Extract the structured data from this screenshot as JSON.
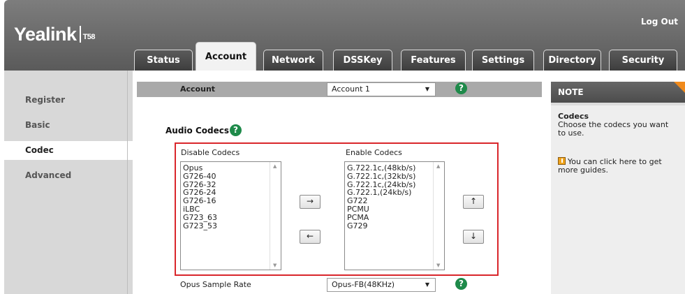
{
  "header": {
    "brand": "Yealink",
    "model": "T58",
    "logout": "Log Out"
  },
  "tabs": [
    {
      "label": "Status",
      "active": false
    },
    {
      "label": "Account",
      "active": true
    },
    {
      "label": "Network",
      "active": false
    },
    {
      "label": "DSSKey",
      "active": false
    },
    {
      "label": "Features",
      "active": false
    },
    {
      "label": "Settings",
      "active": false
    },
    {
      "label": "Directory",
      "active": false
    },
    {
      "label": "Security",
      "active": false
    }
  ],
  "sidebar": {
    "items": [
      {
        "label": "Register",
        "active": false
      },
      {
        "label": "Basic",
        "active": false
      },
      {
        "label": "Codec",
        "active": true
      },
      {
        "label": "Advanced",
        "active": false
      }
    ]
  },
  "account": {
    "label": "Account",
    "selected": "Account 1"
  },
  "audio_codecs": {
    "label": "Audio Codecs",
    "disable_title": "Disable Codecs",
    "enable_title": "Enable Codecs",
    "disabled": [
      "Opus",
      "G726-40",
      "G726-32",
      "G726-24",
      "G726-16",
      "iLBC",
      "G723_63",
      "G723_53"
    ],
    "enabled": [
      "G.722.1c,(48kb/s)",
      "G.722.1c,(32kb/s)",
      "G.722.1c,(24kb/s)",
      "G.722.1,(24kb/s)",
      "G722",
      "PCMU",
      "PCMA",
      "G729"
    ],
    "move_right": "→",
    "move_left": "←",
    "move_up": "↑",
    "move_down": "↓"
  },
  "opus": {
    "label": "Opus Sample Rate",
    "selected": "Opus-FB(48KHz)"
  },
  "note": {
    "heading": "NOTE",
    "title": "Codecs",
    "text": "Choose the codecs you want to use.",
    "guide": "You can click here to get more guides."
  },
  "icons": {
    "help": "help-icon",
    "dropdown": "chevron-down-icon",
    "guide": "guide-icon"
  },
  "colors": {
    "accent_green": "#1e8a4a",
    "highlight_red": "#d9262b",
    "note_corner": "#f08a1c"
  }
}
